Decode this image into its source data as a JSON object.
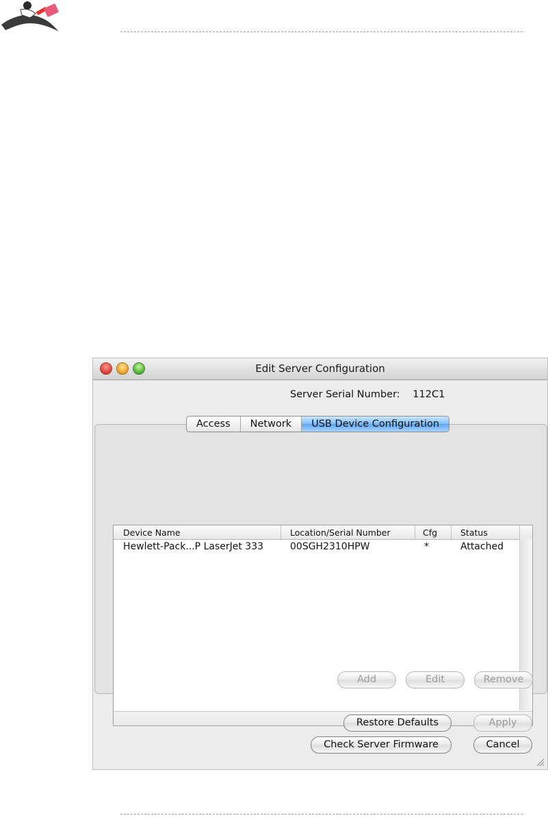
{
  "window": {
    "title": "Edit Server Configuration"
  },
  "server": {
    "serial_label": "Server Serial Number:",
    "serial_value": "112C1"
  },
  "tabs": [
    {
      "label": "Access",
      "selected": false
    },
    {
      "label": "Network",
      "selected": false
    },
    {
      "label": "USB Device Configuration",
      "selected": true
    }
  ],
  "device_table": {
    "columns": [
      "Device Name",
      "Location/Serial Number",
      "Cfg",
      "Status"
    ],
    "rows": [
      {
        "device_name": "Hewlett-Pack...P LaserJet 333",
        "location": "00SGH2310HPW",
        "cfg": "*",
        "status": "Attached"
      }
    ]
  },
  "device_buttons": {
    "add": "Add",
    "edit": "Edit",
    "remove": "Remove"
  },
  "footer_buttons": {
    "restore_defaults": "Restore Defaults",
    "apply": "Apply",
    "check_firmware": "Check Server Firmware",
    "cancel": "Cancel"
  },
  "colors": {
    "selected_tab": "#7ebcf6",
    "close_button": "#e0443a",
    "minimize_button": "#f0a733",
    "zoom_button": "#59b83b"
  }
}
